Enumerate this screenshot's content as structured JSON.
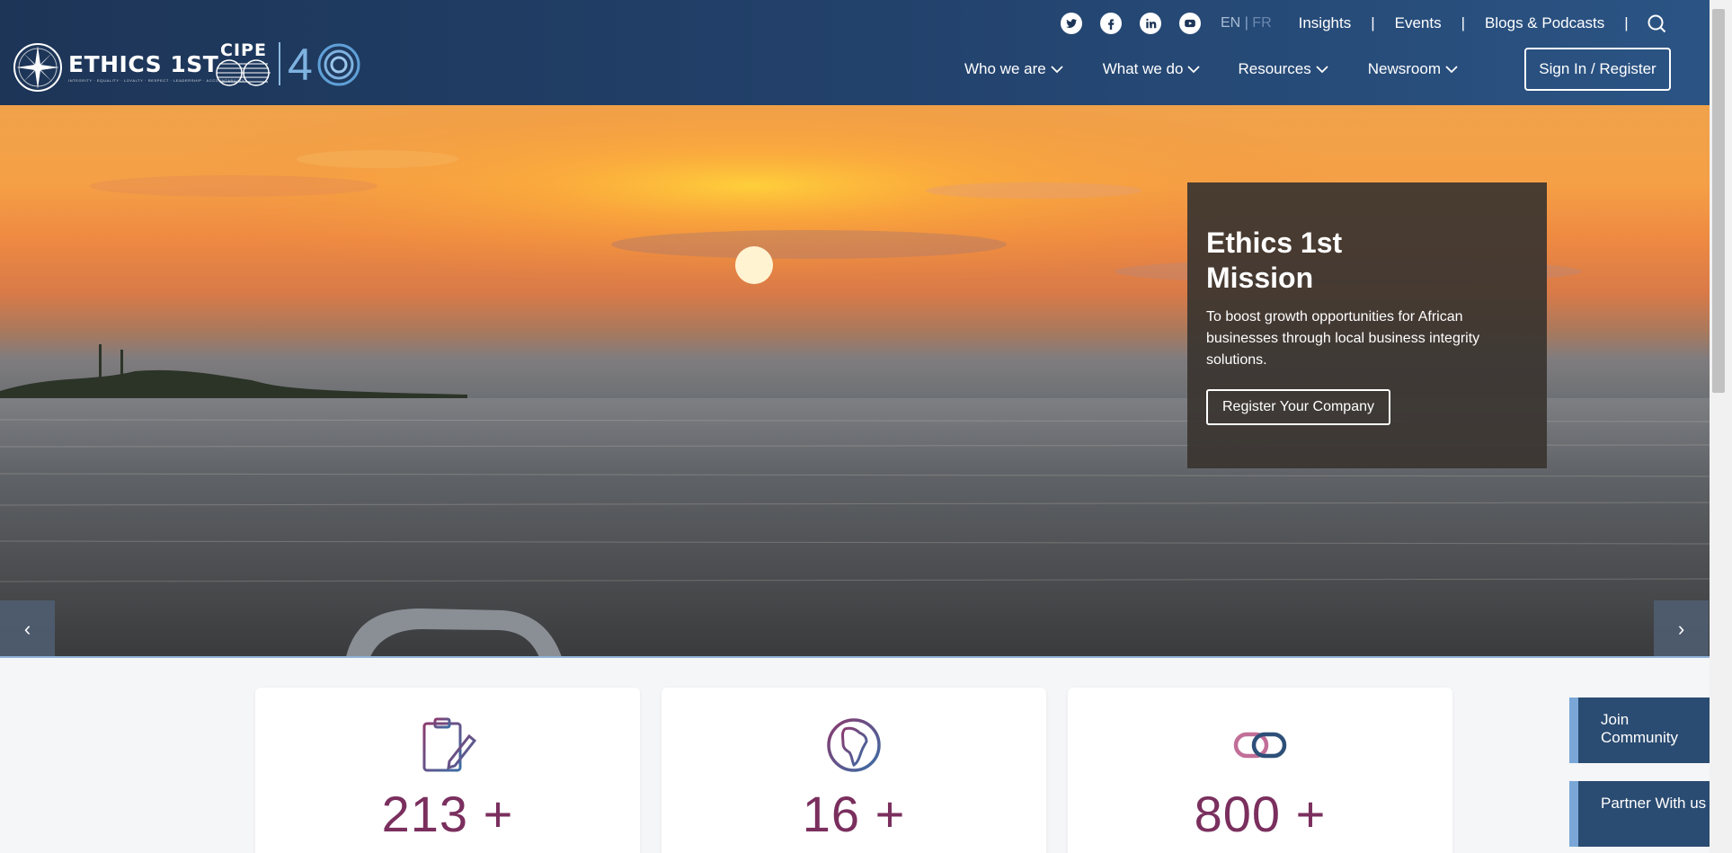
{
  "brand": {
    "logo_name": "ETHICS 1ST",
    "logo_tagline": "INTEGRITY · EQUALITY · LOYALTY · RESPECT · LEADERSHIP · ACCOUNTABILITY",
    "partner_name": "CIPE",
    "partner_number": "40"
  },
  "topbar": {
    "social_icons": [
      "twitter-icon",
      "facebook-icon",
      "linkedin-icon",
      "youtube-icon"
    ],
    "lang_en": "EN",
    "lang_sep": "|",
    "lang_fr": "FR",
    "links": [
      "Insights",
      "Events",
      "Blogs & Podcasts"
    ],
    "sep": "|"
  },
  "nav": {
    "items": [
      {
        "label": "Who we are"
      },
      {
        "label": "What we do"
      },
      {
        "label": "Resources"
      },
      {
        "label": "Newsroom"
      }
    ],
    "signin": "Sign In / Register"
  },
  "hero": {
    "title": "Ethics 1st Mission",
    "text": "To boost growth opportunities for African businesses through local business integrity solutions.",
    "button": "Register Your Company",
    "prev": "‹",
    "next": "›"
  },
  "stats": [
    {
      "icon": "clipboard-icon",
      "value": "213 +"
    },
    {
      "icon": "globe-africa-icon",
      "value": "16 +"
    },
    {
      "icon": "link-icon",
      "value": "800 +"
    }
  ],
  "side_tabs": {
    "join": "Join Community",
    "partner": "Partner With us"
  },
  "colors": {
    "header": "#1d3557",
    "stat_value": "#7a2f5e",
    "side_tab": "#2b4c72",
    "side_tab_accent": "#7aa7d8"
  }
}
